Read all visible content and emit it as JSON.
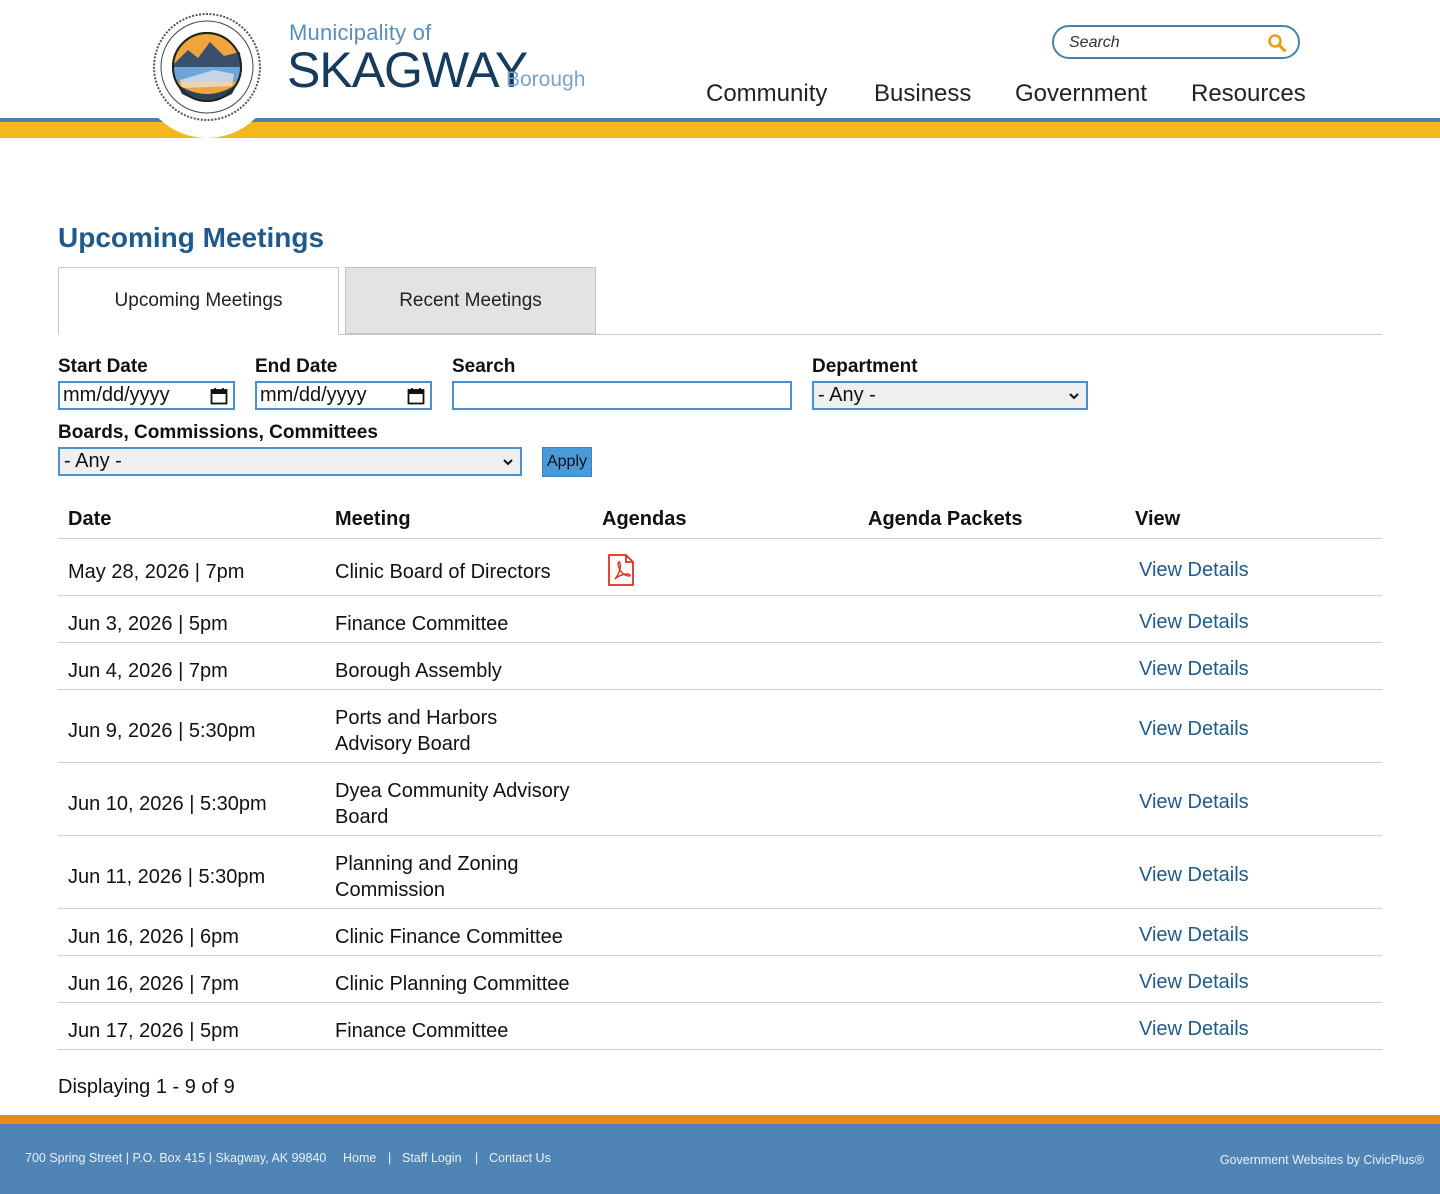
{
  "header": {
    "logo_small": "Municipality of",
    "logo_big": "SKAGWAY",
    "logo_sub": "Borough",
    "search_placeholder": "Search",
    "nav": [
      "Community",
      "Business",
      "Government",
      "Resources"
    ]
  },
  "main": {
    "title": "Upcoming Meetings",
    "tabs": [
      {
        "label": "Upcoming Meetings",
        "active": true
      },
      {
        "label": "Recent Meetings",
        "active": false
      }
    ],
    "filters": {
      "start_date_label": "Start Date",
      "start_date_value": "mm/dd/yyyy",
      "end_date_label": "End Date",
      "end_date_value": "mm/dd/yyyy",
      "search_label": "Search",
      "search_value": "",
      "department_label": "Department",
      "department_value": "- Any -",
      "boards_label": "Boards, Commissions, Committees",
      "boards_value": "- Any -",
      "apply_label": "Apply"
    },
    "table": {
      "headers": [
        "Date",
        "Meeting",
        "Agendas",
        "Agenda Packets",
        "View"
      ],
      "rows": [
        {
          "date": "May 28, 2026 | 7pm",
          "meeting_line1": "Clinic Board of Directors",
          "meeting_line2": "",
          "has_agenda_pdf": true,
          "view": "View Details"
        },
        {
          "date": "Jun 3, 2026 | 5pm",
          "meeting_line1": "Finance Committee",
          "meeting_line2": "",
          "has_agenda_pdf": false,
          "view": "View Details"
        },
        {
          "date": "Jun 4, 2026 | 7pm",
          "meeting_line1": "Borough Assembly",
          "meeting_line2": "",
          "has_agenda_pdf": false,
          "view": "View Details"
        },
        {
          "date": "Jun 9, 2026 | 5:30pm",
          "meeting_line1": "Ports and Harbors",
          "meeting_line2": "Advisory Board",
          "has_agenda_pdf": false,
          "view": "View Details"
        },
        {
          "date": "Jun 10, 2026 | 5:30pm",
          "meeting_line1": "Dyea Community Advisory",
          "meeting_line2": "Board",
          "has_agenda_pdf": false,
          "view": "View Details"
        },
        {
          "date": "Jun 11, 2026 | 5:30pm",
          "meeting_line1": "Planning and Zoning",
          "meeting_line2": "Commission",
          "has_agenda_pdf": false,
          "view": "View Details"
        },
        {
          "date": "Jun 16, 2026 | 6pm",
          "meeting_line1": "Clinic Finance Committee",
          "meeting_line2": "",
          "has_agenda_pdf": false,
          "view": "View Details"
        },
        {
          "date": "Jun 16, 2026 | 7pm",
          "meeting_line1": "Clinic Planning Committee",
          "meeting_line2": "",
          "has_agenda_pdf": false,
          "view": "View Details"
        },
        {
          "date": "Jun 17, 2026 | 5pm",
          "meeting_line1": "Finance Committee",
          "meeting_line2": "",
          "has_agenda_pdf": false,
          "view": "View Details"
        }
      ]
    },
    "displaying": "Displaying 1 - 9 of 9"
  },
  "footer": {
    "address": "700 Spring Street | P.O. Box 415 | Skagway, AK 99840",
    "links": [
      "Home",
      "Staff Login",
      "Contact Us"
    ],
    "credit": "Government Websites by CivicPlus®"
  },
  "colors": {
    "brand_blue": "#1f5a8a",
    "stripe_yellow": "#f5b81c",
    "footer_blue": "#4f84b5",
    "footer_orange": "#e8891c"
  }
}
